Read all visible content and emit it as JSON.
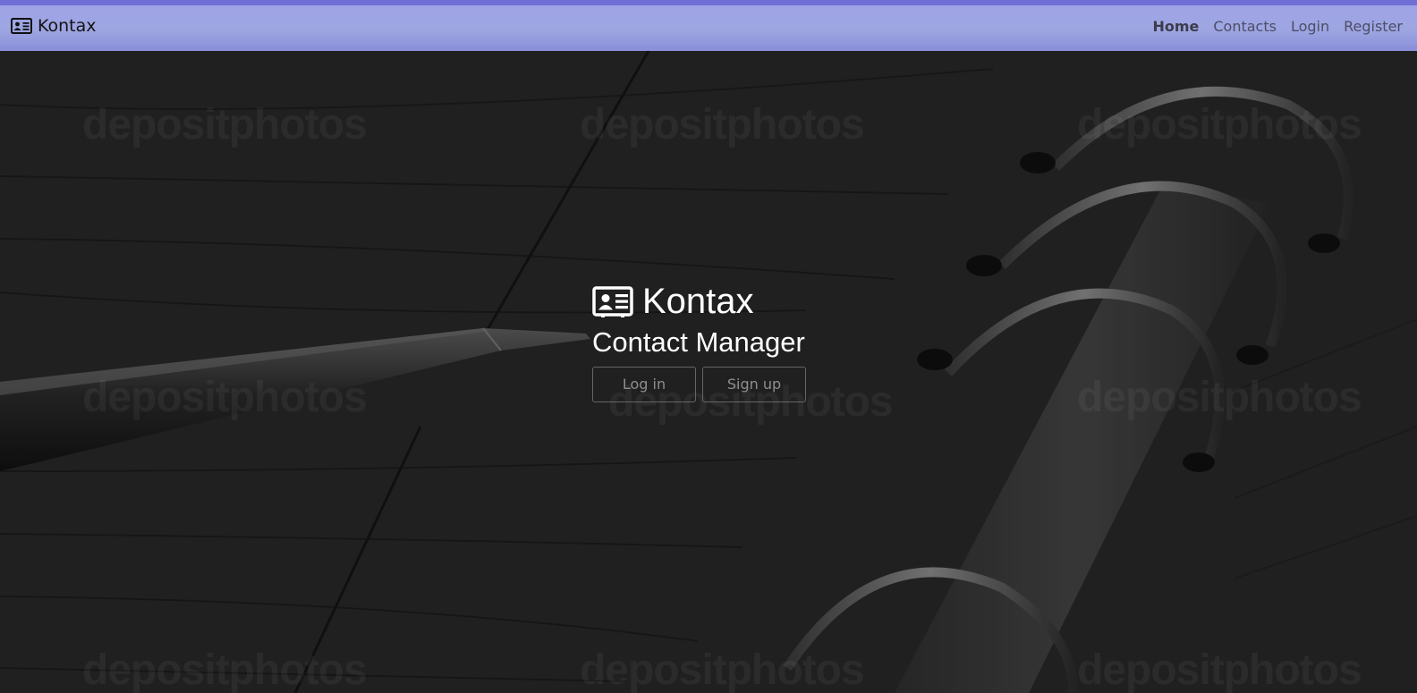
{
  "navbar": {
    "brand": "Kontax",
    "brand_icon": "id-card-icon",
    "links": [
      "Home",
      "Contacts",
      "Login",
      "Register"
    ],
    "active": "Home",
    "bg_color": "#9ea6e2"
  },
  "hero": {
    "title": "Kontax",
    "subtitle": "Contact Manager",
    "login_label": "Log in",
    "signup_label": "Sign up",
    "logo_icon": "id-card-icon",
    "watermark": "depositphotos"
  }
}
